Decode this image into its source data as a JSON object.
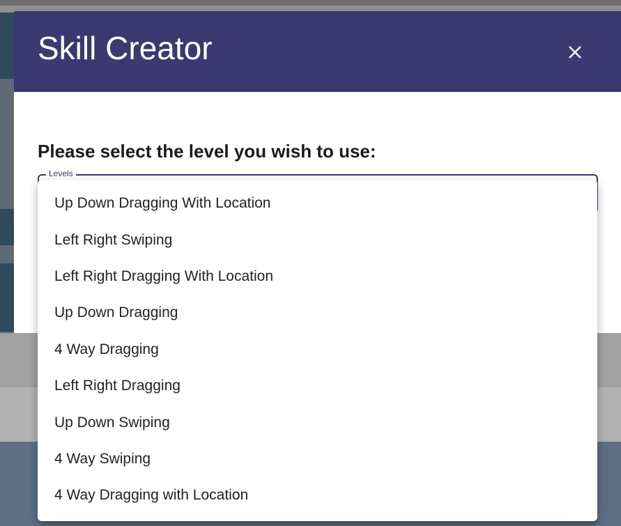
{
  "dialog": {
    "title": "Skill Creator",
    "prompt": "Please select the level you wish to use:",
    "select_label": "Levels"
  },
  "menu": {
    "options": [
      "Up Down Dragging With Location",
      "Left Right Swiping",
      "Left Right Dragging With Location",
      "Up Down Dragging",
      "4 Way Dragging",
      "Left Right Dragging",
      "Up Down Swiping",
      "4 Way Swiping",
      "4 Way Dragging with Location"
    ]
  },
  "colors": {
    "header": "#3c3970",
    "overlay_bottom": "#5f6e84"
  },
  "icons": {
    "close": "close-icon"
  }
}
